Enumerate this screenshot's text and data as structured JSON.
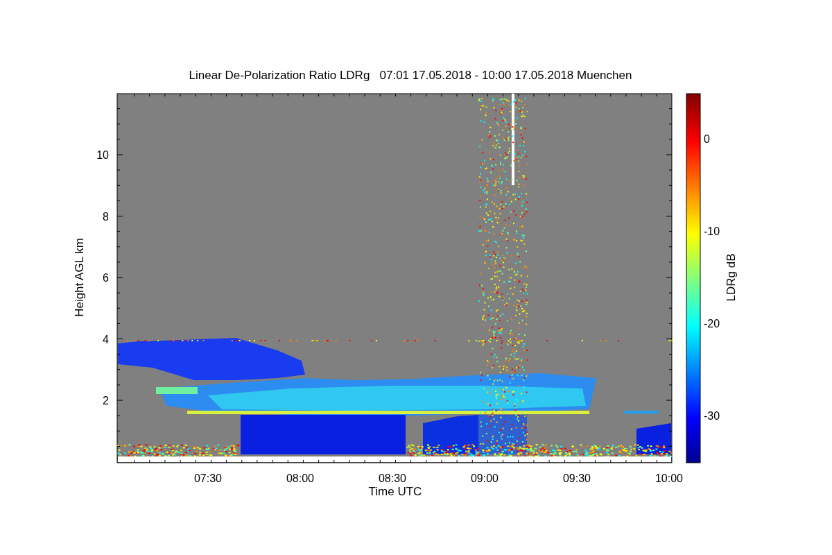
{
  "title": "Linear De-Polarization Ratio LDRg   07:01 17.05.2018 - 10:00 17.05.2018 Muenchen",
  "x_axis": {
    "label": "Time UTC",
    "ticks": [
      "07:30",
      "08:00",
      "08:30",
      "09:00",
      "09:30",
      "10:00"
    ]
  },
  "y_axis": {
    "label": "Height AGL km",
    "ticks": [
      "10",
      "8",
      "6",
      "4",
      "2"
    ]
  },
  "colorbar": {
    "label": "LDRg dB",
    "ticks": [
      "0",
      "-10",
      "-20",
      "-30"
    ]
  }
}
